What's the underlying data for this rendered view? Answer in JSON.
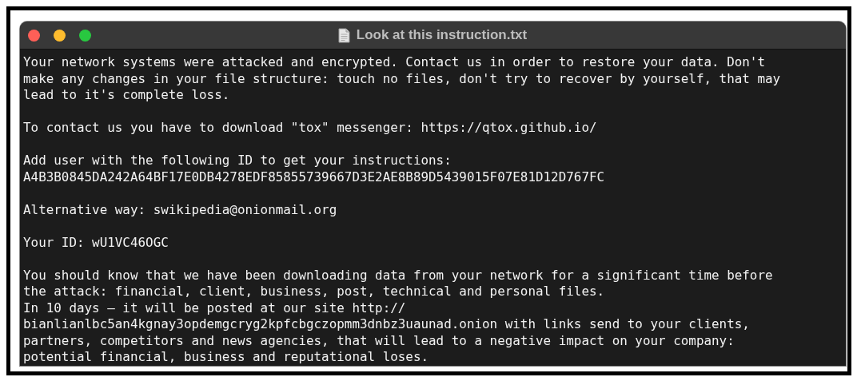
{
  "window": {
    "title": "Look at this instruction.txt"
  },
  "document": {
    "sections": [
      [
        {
          "lines": [
            "Your network systems were attacked and encrypted. Contact us in order to restore your data. Don't",
            "make any changes in your file structure: touch no files, don't try to recover by yourself, that may",
            "lead to it's complete loss."
          ]
        }
      ],
      [
        {
          "lines": [
            "To contact us you have to download \"tox\" messenger: https://qtox.github.io/"
          ]
        }
      ],
      [
        {
          "lines": [
            "Add user with the following ID to get your instructions:",
            "A4B3B0845DA242A64BF17E0DB4278EDF85855739667D3E2AE8B89D5439015F07E81D12D767FC"
          ]
        }
      ],
      [
        {
          "lines": [
            "Alternative way: swikipedia@onionmail.org"
          ]
        }
      ],
      [
        {
          "lines": [
            "Your ID: wU1VC46OGC"
          ]
        }
      ],
      [
        {
          "lines": [
            "You should know that we have been downloading data from your network for a significant time before",
            "the attack: financial, client, business, post, technical and personal files."
          ]
        },
        {
          "lines": [
            "In 10 days – it will be posted at our site http://",
            "bianlianlbc5an4kgnay3opdemgcryg2kpfcbgczopmm3dnbz3uaunad.onion with links send to your clients,",
            "partners, competitors and news agencies, that will lead to a negative impact on your company:",
            "potential financial, business and reputational loses."
          ]
        }
      ]
    ]
  }
}
